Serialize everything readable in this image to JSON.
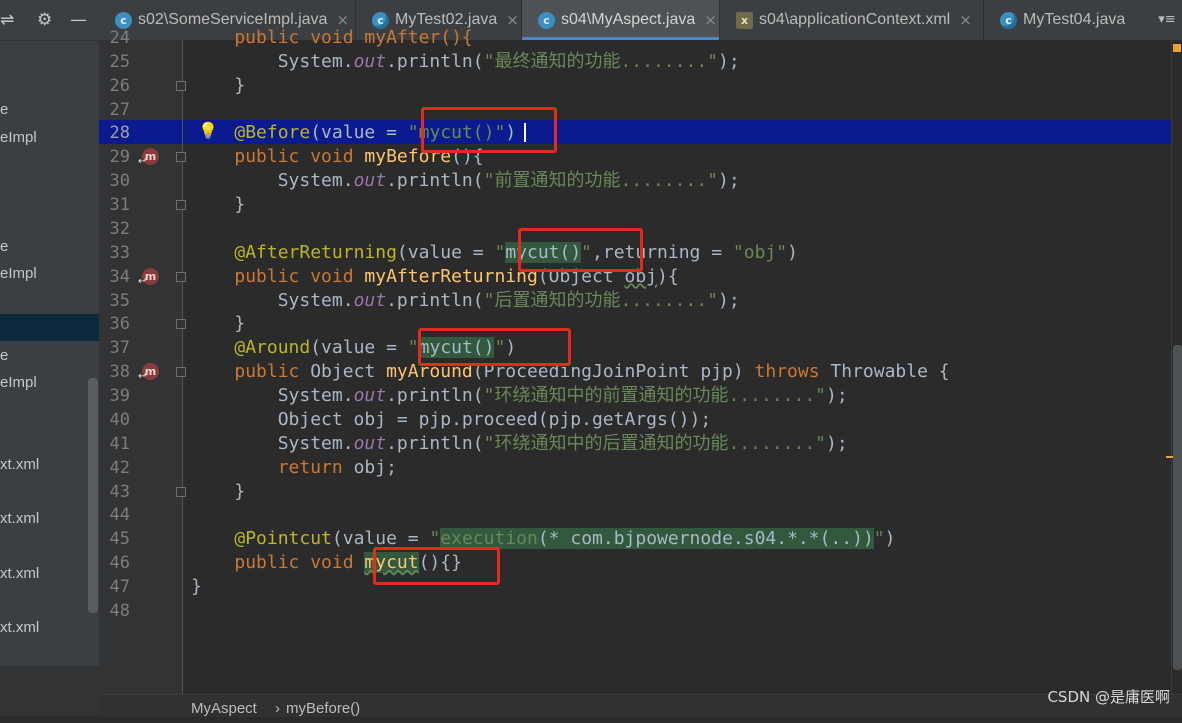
{
  "left_panel": {
    "toolbar_icons": [
      "collapse-icon",
      "gear-icon",
      "minimize-icon"
    ],
    "items": [
      "e",
      "eImpl",
      "e",
      "eImpl",
      "e",
      "eImpl",
      "xt.xml",
      "xt.xml",
      "xt.xml",
      "xt.xml"
    ]
  },
  "tabs": [
    {
      "label": "s02\\SomeServiceImpl.java",
      "icon": "class-icon",
      "active": false
    },
    {
      "label": "MyTest02.java",
      "icon": "test-class-icon",
      "active": false
    },
    {
      "label": "s04\\MyAspect.java",
      "icon": "class-icon",
      "active": true
    },
    {
      "label": "s04\\applicationContext.xml",
      "icon": "xml-file-icon",
      "active": false
    },
    {
      "label": "MyTest04.java",
      "icon": "test-class-icon",
      "active": false
    }
  ],
  "tab_close": "×",
  "tab_overflow": "▾≡",
  "editor": {
    "current_line": "28",
    "lines": [
      {
        "n": "24",
        "t": [
          "    public void myAfter(){"
        ]
      },
      {
        "n": "25",
        "t": [
          "        System.",
          "out",
          ".println(",
          "\"最终通知的功能........\"",
          ");"
        ]
      },
      {
        "n": "26",
        "t": [
          "    }"
        ]
      },
      {
        "n": "27",
        "t": [
          ""
        ]
      },
      {
        "n": "28",
        "t": [
          "    ",
          "@Before",
          "(value = ",
          "\"mycut()\"",
          ")"
        ]
      },
      {
        "n": "29",
        "t": [
          "    ",
          "public void ",
          "myBefore",
          "(){"
        ]
      },
      {
        "n": "30",
        "t": [
          "        System.",
          "out",
          ".println(",
          "\"前置通知的功能........\"",
          ");"
        ]
      },
      {
        "n": "31",
        "t": [
          "    }"
        ]
      },
      {
        "n": "32",
        "t": [
          ""
        ]
      },
      {
        "n": "33",
        "t": [
          "    ",
          "@AfterReturning",
          "(value = ",
          "\"",
          "mycut()",
          "\"",
          ",returning = ",
          "\"obj\"",
          ")"
        ]
      },
      {
        "n": "34",
        "t": [
          "    ",
          "public void ",
          "myAfterReturning",
          "(Object ",
          "obj",
          "){"
        ]
      },
      {
        "n": "35",
        "t": [
          "        System.",
          "out",
          ".println(",
          "\"后置通知的功能........\"",
          ");"
        ]
      },
      {
        "n": "36",
        "t": [
          "    }"
        ]
      },
      {
        "n": "37",
        "t": [
          "    ",
          "@Around",
          "(value = ",
          "\"",
          "mycut()",
          "\"",
          ")"
        ]
      },
      {
        "n": "38",
        "t": [
          "    ",
          "public ",
          "Object ",
          "myAround",
          "(ProceedingJoinPoint pjp) ",
          "throws ",
          "Throwable {"
        ]
      },
      {
        "n": "39",
        "t": [
          "        System.",
          "out",
          ".println(",
          "\"环绕通知中的前置通知的功能........\"",
          ");"
        ]
      },
      {
        "n": "40",
        "t": [
          "        Object obj = pjp.proceed(pjp.getArgs());"
        ]
      },
      {
        "n": "41",
        "t": [
          "        System.",
          "out",
          ".println(",
          "\"环绕通知中的后置通知的功能........\"",
          ");"
        ]
      },
      {
        "n": "42",
        "t": [
          "        ",
          "return ",
          "obj;"
        ]
      },
      {
        "n": "43",
        "t": [
          "    }"
        ]
      },
      {
        "n": "44",
        "t": [
          ""
        ]
      },
      {
        "n": "45",
        "t": [
          "    ",
          "@Pointcut",
          "(value = ",
          "\"",
          "execution",
          "(* com.bjpowernode.s04.*.*(..))",
          "\"",
          ")"
        ]
      },
      {
        "n": "46",
        "t": [
          "    ",
          "public void ",
          "mycut",
          "(){}"
        ]
      },
      {
        "n": "47",
        "t": [
          "}"
        ]
      },
      {
        "n": "48",
        "t": [
          ""
        ]
      }
    ]
  },
  "breadcrumb": {
    "class": "MyAspect",
    "separator": "›",
    "method": "myBefore()"
  },
  "watermark": "CSDN @是庸医啊",
  "colors": {
    "keyword": "#cc7832",
    "annotation": "#bbb529",
    "string": "#6a8759",
    "method": "#ffc66d",
    "field": "#9876aa",
    "highlight": "#0b1b8f",
    "annotation_box": "#e32a1f"
  }
}
